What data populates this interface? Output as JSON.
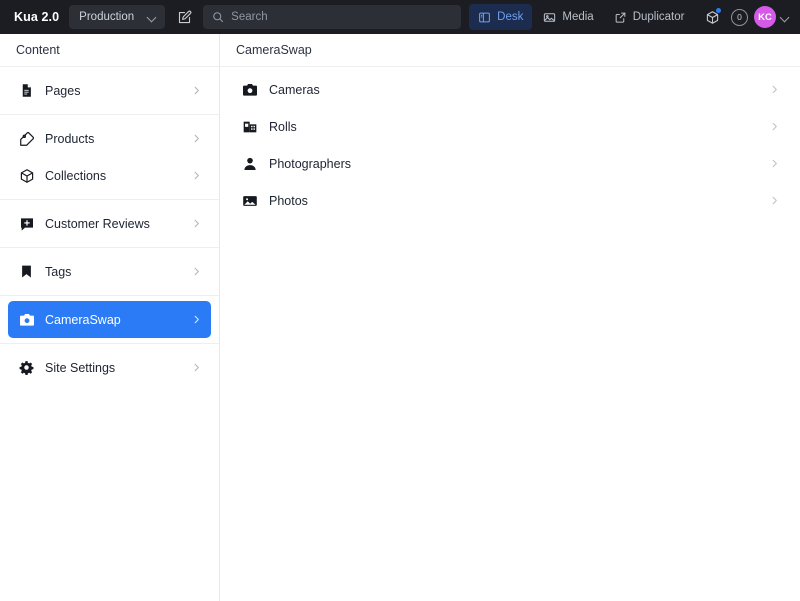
{
  "topbar": {
    "brand": "Kua 2.0",
    "environment": {
      "value": "Production",
      "icon": "chevron-down-icon"
    },
    "edit_icon": "edit-square-icon",
    "search": {
      "placeholder": "Search",
      "icon": "search-icon",
      "value": ""
    },
    "nav": [
      {
        "label": "Desk",
        "icon": "desk-panel-icon",
        "active": true
      },
      {
        "label": "Media",
        "icon": "media-image-icon",
        "active": false
      },
      {
        "label": "Duplicator",
        "icon": "external-link-icon",
        "active": false
      }
    ],
    "package_icon": "package-cube-icon",
    "package_has_notification": true,
    "notification_count": "0",
    "avatar": {
      "initials": "KC",
      "color": "#d65ae8"
    },
    "avatar_chevron": "chevron-down-icon",
    "colors": {
      "bar_bg": "#1b1d22",
      "field_bg": "#2c2f36",
      "active_tab_bg": "#1c2c4f",
      "active_tab_fg": "#6ea0ef",
      "accent_dot": "#2a7bf6"
    }
  },
  "sidebar": {
    "title": "Content",
    "groups": [
      {
        "items": [
          {
            "label": "Pages",
            "icon": "document-icon",
            "selected": false
          }
        ]
      },
      {
        "items": [
          {
            "label": "Products",
            "icon": "tag-icon",
            "selected": false
          },
          {
            "label": "Collections",
            "icon": "cube-box-icon",
            "selected": false
          }
        ]
      },
      {
        "items": [
          {
            "label": "Customer Reviews",
            "icon": "comment-plus-icon",
            "selected": false
          }
        ]
      },
      {
        "items": [
          {
            "label": "Tags",
            "icon": "bookmark-icon",
            "selected": false
          }
        ]
      },
      {
        "items": [
          {
            "label": "CameraSwap",
            "icon": "camera-icon",
            "selected": true
          }
        ]
      },
      {
        "items": [
          {
            "label": "Site Settings",
            "icon": "gear-icon",
            "selected": false
          }
        ]
      }
    ],
    "selected_color": "#2b7bf6"
  },
  "main": {
    "title": "CameraSwap",
    "items": [
      {
        "label": "Cameras",
        "icon": "camera-icon"
      },
      {
        "label": "Rolls",
        "icon": "film-roll-icon"
      },
      {
        "label": "Photographers",
        "icon": "person-icon"
      },
      {
        "label": "Photos",
        "icon": "image-icon"
      }
    ]
  }
}
